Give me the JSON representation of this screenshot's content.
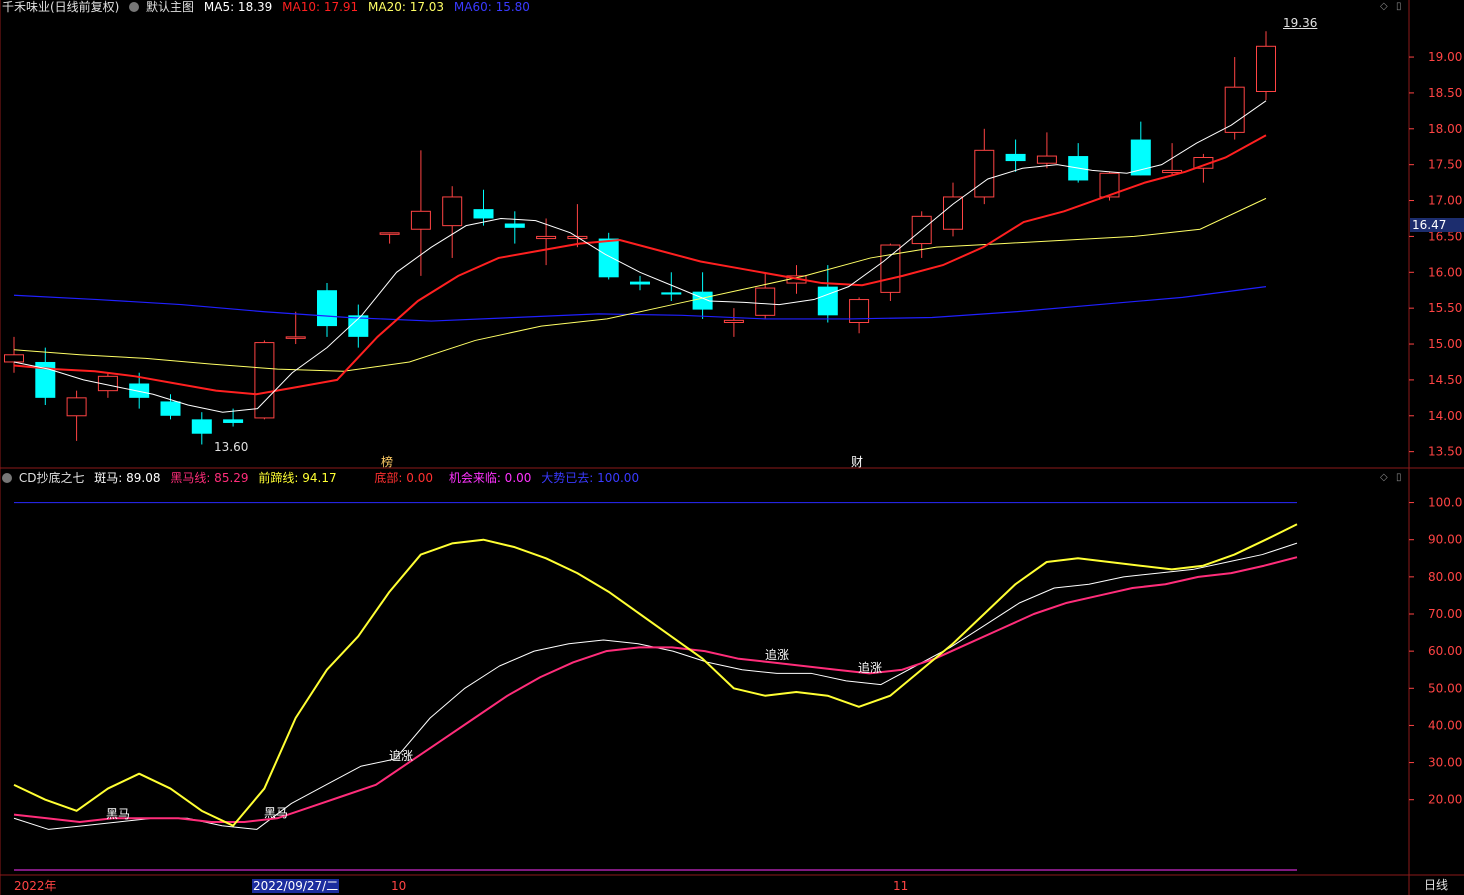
{
  "main_header": {
    "stock": "千禾味业(日线前复权)",
    "template": "默认主图",
    "ma5": "MA5: 18.39",
    "ma10": "MA10: 17.91",
    "ma20": "MA20: 17.03",
    "ma60": "MA60: 15.80"
  },
  "sub_header": {
    "name": "CD抄底之七",
    "banma": "斑马: 89.08",
    "heima": "黑马线: 85.29",
    "qiantiao": "前蹄线: 94.17",
    "dibu": "底部: 0.00",
    "jihui": "机会来临: 0.00",
    "dashi": "大势已去: 100.00"
  },
  "colors": {
    "bg": "#000000",
    "frame": "#8b1a1a",
    "up": "#ff4444",
    "down": "#00ffff",
    "ma5": "#ffffff",
    "ma10": "#ff2020",
    "ma20": "#ffff66",
    "ma60": "#2020ff",
    "banma": "#ffffff",
    "heima": "#ff2d7a",
    "qiantiao": "#ffff33",
    "axis_text": "#ff4444",
    "date_text": "#ff4444"
  },
  "price_axis_ticks": [
    "19.00",
    "18.50",
    "18.00",
    "17.50",
    "17.00",
    "16.50",
    "16.00",
    "15.50",
    "15.00",
    "14.50",
    "14.00",
    "13.50"
  ],
  "current_price_tag": "16.47",
  "high_label": "19.36",
  "low_label": "13.60",
  "event_marks": [
    "榜",
    "财"
  ],
  "indicator_axis_ticks": [
    "100.0",
    "90.00",
    "80.00",
    "70.00",
    "60.00",
    "50.00",
    "40.00",
    "30.00",
    "20.00"
  ],
  "signal_labels": [
    "黑马",
    "黑马",
    "追涨",
    "追涨",
    "追涨"
  ],
  "date_labels": [
    "2022年",
    "2022/09/27/二",
    "10",
    "11"
  ],
  "period_label": "日线",
  "chart_data": [
    {
      "type": "candlestick",
      "title": "千禾味业(日线前复权)",
      "ylim": [
        13.3,
        19.6
      ],
      "candles": [
        {
          "o": 14.75,
          "h": 15.1,
          "l": 14.6,
          "c": 14.85
        },
        {
          "o": 14.75,
          "h": 14.95,
          "l": 14.15,
          "c": 14.25
        },
        {
          "o": 14.0,
          "h": 14.35,
          "l": 13.65,
          "c": 14.25
        },
        {
          "o": 14.35,
          "h": 14.6,
          "l": 14.25,
          "c": 14.55
        },
        {
          "o": 14.45,
          "h": 14.6,
          "l": 14.1,
          "c": 14.25
        },
        {
          "o": 14.2,
          "h": 14.3,
          "l": 13.95,
          "c": 14.0
        },
        {
          "o": 13.95,
          "h": 14.05,
          "l": 13.6,
          "c": 13.75
        },
        {
          "o": 13.95,
          "h": 14.1,
          "l": 13.85,
          "c": 13.9
        },
        {
          "o": 13.97,
          "h": 15.05,
          "l": 13.95,
          "c": 15.02
        },
        {
          "o": 15.08,
          "h": 15.45,
          "l": 15.0,
          "c": 15.1
        },
        {
          "o": 15.75,
          "h": 15.85,
          "l": 15.1,
          "c": 15.25
        },
        {
          "o": 15.4,
          "h": 15.55,
          "l": 14.95,
          "c": 15.1
        },
        {
          "o": 16.55,
          "h": 16.55,
          "l": 16.4,
          "c": 16.55
        },
        {
          "o": 16.6,
          "h": 17.7,
          "l": 15.95,
          "c": 16.85
        },
        {
          "o": 16.65,
          "h": 17.2,
          "l": 16.2,
          "c": 17.05
        },
        {
          "o": 16.88,
          "h": 17.15,
          "l": 16.65,
          "c": 16.75
        },
        {
          "o": 16.68,
          "h": 16.85,
          "l": 16.4,
          "c": 16.62
        },
        {
          "o": 16.47,
          "h": 16.75,
          "l": 16.1,
          "c": 16.5
        },
        {
          "o": 16.47,
          "h": 16.95,
          "l": 16.35,
          "c": 16.5
        },
        {
          "o": 16.47,
          "h": 16.55,
          "l": 15.9,
          "c": 15.93
        },
        {
          "o": 15.87,
          "h": 15.95,
          "l": 15.75,
          "c": 15.83
        },
        {
          "o": 15.72,
          "h": 16.0,
          "l": 15.6,
          "c": 15.69
        },
        {
          "o": 15.73,
          "h": 16.0,
          "l": 15.35,
          "c": 15.48
        },
        {
          "o": 15.3,
          "h": 15.5,
          "l": 15.1,
          "c": 15.33
        },
        {
          "o": 15.4,
          "h": 16.0,
          "l": 15.35,
          "c": 15.78
        },
        {
          "o": 15.85,
          "h": 16.1,
          "l": 15.7,
          "c": 15.95
        },
        {
          "o": 15.8,
          "h": 16.1,
          "l": 15.3,
          "c": 15.4
        },
        {
          "o": 15.3,
          "h": 15.65,
          "l": 15.15,
          "c": 15.62
        },
        {
          "o": 15.72,
          "h": 16.4,
          "l": 15.6,
          "c": 16.38
        },
        {
          "o": 16.4,
          "h": 16.85,
          "l": 16.2,
          "c": 16.78
        },
        {
          "o": 16.6,
          "h": 17.25,
          "l": 16.5,
          "c": 17.05
        },
        {
          "o": 17.05,
          "h": 18.0,
          "l": 16.95,
          "c": 17.7
        },
        {
          "o": 17.65,
          "h": 17.85,
          "l": 17.4,
          "c": 17.55
        },
        {
          "o": 17.52,
          "h": 17.95,
          "l": 17.45,
          "c": 17.62
        },
        {
          "o": 17.62,
          "h": 17.8,
          "l": 17.25,
          "c": 17.28
        },
        {
          "o": 17.05,
          "h": 17.4,
          "l": 17.0,
          "c": 17.38
        },
        {
          "o": 17.85,
          "h": 18.1,
          "l": 17.35,
          "c": 17.35
        },
        {
          "o": 17.39,
          "h": 17.8,
          "l": 17.35,
          "c": 17.42
        },
        {
          "o": 17.45,
          "h": 17.65,
          "l": 17.25,
          "c": 17.6
        },
        {
          "o": 17.95,
          "h": 19.0,
          "l": 17.85,
          "c": 18.58
        },
        {
          "o": 18.52,
          "h": 19.36,
          "l": 18.4,
          "c": 19.15
        }
      ],
      "ma5": [
        14.75,
        14.65,
        14.5,
        14.4,
        14.3,
        14.15,
        14.05,
        14.1,
        14.6,
        14.95,
        15.4,
        16.0,
        16.35,
        16.65,
        16.75,
        16.72,
        16.55,
        16.25,
        16.0,
        15.8,
        15.6,
        15.58,
        15.55,
        15.62,
        15.8,
        16.15,
        16.55,
        16.95,
        17.3,
        17.45,
        17.5,
        17.42,
        17.38,
        17.5,
        17.8,
        18.05,
        18.39
      ],
      "ma10": [
        14.7,
        14.65,
        14.62,
        14.55,
        14.45,
        14.35,
        14.3,
        14.4,
        14.5,
        15.1,
        15.6,
        15.95,
        16.2,
        16.3,
        16.4,
        16.45,
        16.3,
        16.15,
        16.05,
        15.95,
        15.85,
        15.82,
        15.95,
        16.1,
        16.35,
        16.7,
        16.85,
        17.05,
        17.25,
        17.4,
        17.6,
        17.91
      ],
      "ma20": [
        14.92,
        14.85,
        14.8,
        14.72,
        14.65,
        14.62,
        14.75,
        15.05,
        15.25,
        15.35,
        15.55,
        15.75,
        15.95,
        16.2,
        16.35,
        16.4,
        16.45,
        16.5,
        16.6,
        17.03
      ],
      "ma60": [
        15.68,
        15.62,
        15.55,
        15.45,
        15.37,
        15.32,
        15.37,
        15.42,
        15.4,
        15.35,
        15.35,
        15.37,
        15.45,
        15.55,
        15.65,
        15.8
      ]
    },
    {
      "type": "line",
      "title": "CD抄底之七",
      "ylim": [
        0,
        105
      ],
      "series": [
        {
          "name": "斑马",
          "values": [
            15,
            12,
            13,
            14,
            15,
            15,
            13,
            12,
            19,
            24,
            29,
            31,
            42,
            50,
            56,
            60,
            62,
            63,
            62,
            60,
            57,
            55,
            54,
            54,
            52,
            51,
            56,
            61,
            67,
            73,
            77,
            78,
            80,
            81,
            82,
            84,
            86,
            89.08
          ]
        },
        {
          "name": "黑马线",
          "values": [
            16,
            15,
            14,
            15,
            15,
            15,
            14,
            14,
            15,
            18,
            21,
            24,
            30,
            36,
            42,
            48,
            53,
            57,
            60,
            61,
            61,
            60,
            58,
            57,
            56,
            55,
            54,
            55,
            58,
            62,
            66,
            70,
            73,
            75,
            77,
            78,
            80,
            81,
            83,
            85.29
          ]
        },
        {
          "name": "前蹄线",
          "values": [
            24,
            20,
            17,
            23,
            27,
            23,
            17,
            13,
            23,
            42,
            55,
            64,
            76,
            86,
            89,
            90,
            88,
            85,
            81,
            76,
            70,
            64,
            58,
            50,
            48,
            49,
            48,
            45,
            48,
            55,
            62,
            70,
            78,
            84,
            85,
            84,
            83,
            82,
            83,
            86,
            90,
            94.17
          ]
        },
        {
          "name": "大势已去",
          "values": [
            100
          ]
        }
      ]
    }
  ]
}
